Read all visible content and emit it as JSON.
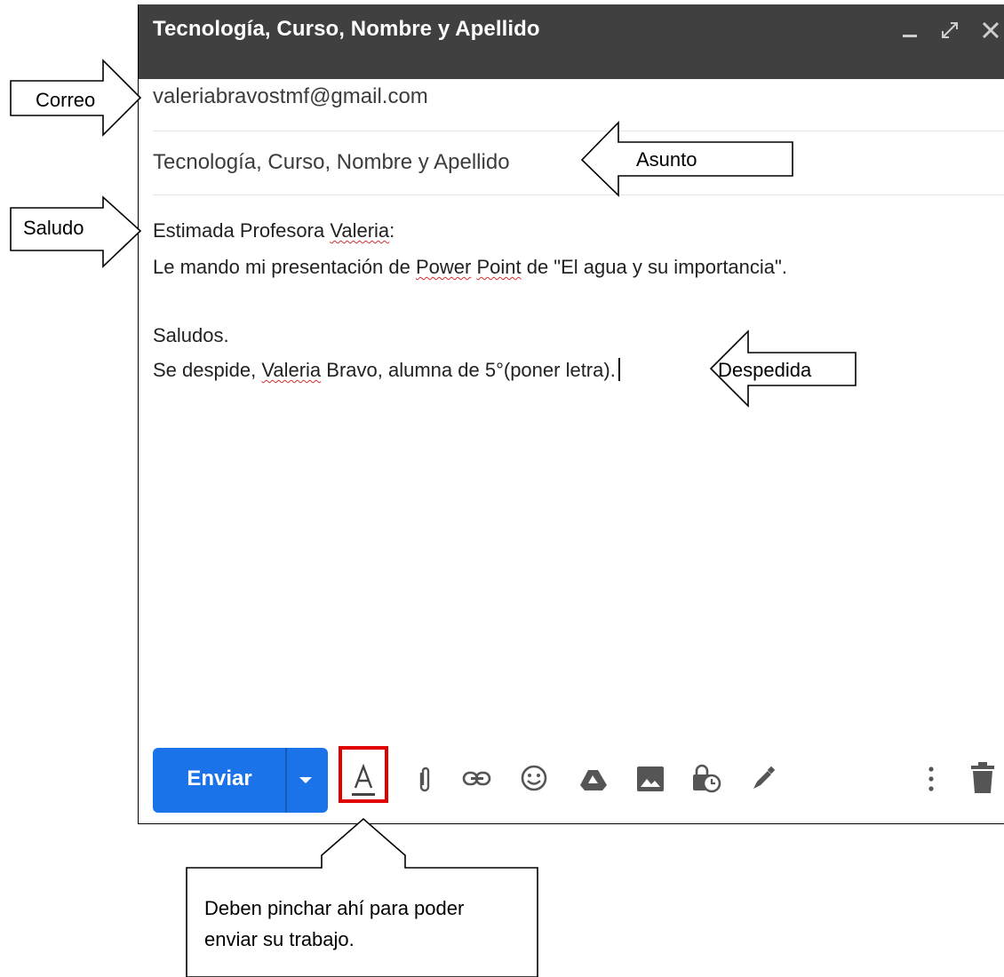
{
  "compose": {
    "title": "Tecnología, Curso, Nombre y Apellido",
    "window_controls": [
      "minimize-icon",
      "expand-icon",
      "close-icon"
    ],
    "to": "valeriabravostmf@gmail.com",
    "subject": "Tecnología, Curso, Nombre y Apellido",
    "body": {
      "l1_pre": "Estimada Profesora ",
      "l1_sq": "Valeria",
      "l1_post": ":",
      "l2_pre": "Le mando mi presentación de ",
      "l2_sq1": "Power",
      "l2_sp": " ",
      "l2_sq2": "Point",
      "l2_post": " de \"El agua y su importancia\".",
      "l3": "Saludos.",
      "l4_pre": "Se despide, ",
      "l4_sq": "Valeria",
      "l4_post": " Bravo, alumna de 5°(poner letra)."
    },
    "toolbar": {
      "send_label": "Enviar",
      "icons": [
        "formatting-icon",
        "attach-icon",
        "link-icon",
        "emoji-icon",
        "drive-icon",
        "photo-icon",
        "confidential-icon",
        "signature-icon",
        "more-options-icon",
        "delete-icon"
      ]
    }
  },
  "annotations": {
    "correo": "Correo",
    "asunto": "Asunto",
    "saludo": "Saludo",
    "despedida": "Despedida",
    "note_line1": "Deben pinchar ahí para poder",
    "note_line2": "enviar su trabajo.",
    "highlight_color": "#e00000"
  }
}
